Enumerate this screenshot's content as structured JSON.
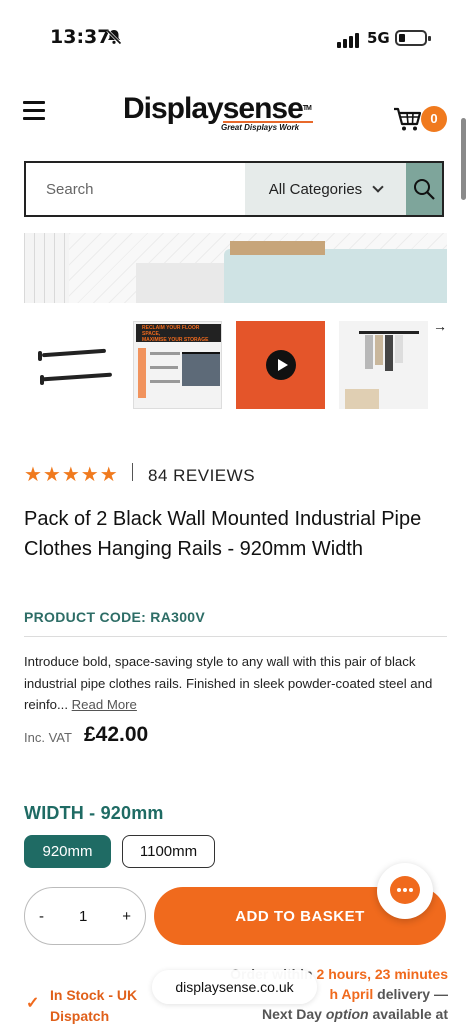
{
  "status_bar": {
    "time": "13:37",
    "network": "5G"
  },
  "header": {
    "logo_main": "Displaysense",
    "logo_tm": "TM",
    "logo_tagline": "Great Displays Work",
    "cart_count": "0"
  },
  "search": {
    "placeholder": "Search",
    "category": "All Categories"
  },
  "gallery": {
    "thumb2_lines": [
      "RECLAIM YOUR FLOOR SPACE,",
      "MAXIMISE YOUR STORAGE"
    ]
  },
  "reviews": {
    "stars": "★★★★★",
    "count_label": "84 REVIEWS"
  },
  "product": {
    "title": "Pack of 2 Black Wall Mounted Industrial Pipe Clothes Hanging Rails - 920mm Width",
    "code": "PRODUCT CODE: RA300V",
    "description": "Introduce bold, space-saving style to any wall with this pair of black industrial pipe clothes rails. Finished in sleek powder-coated steel and reinfo...",
    "read_more": "Read More",
    "vat_label": "Inc. VAT",
    "price": "£42.00"
  },
  "width": {
    "label": "WIDTH - 920mm",
    "options": [
      "920mm",
      "1100mm"
    ],
    "selected": "920mm"
  },
  "purchase": {
    "qty_minus": "-",
    "qty_value": "1",
    "qty_plus": "+",
    "add_label": "ADD TO BASKET"
  },
  "stock": {
    "label": "In Stock - UK Dispatch",
    "delivery_line1_prefix": "Order within",
    "delivery_line1_highlight": "2 hours, 23 minutes",
    "delivery_line2_highlight": "h April",
    "delivery_line2_suffix": "delivery —",
    "delivery_line3_prefix": "Next Day",
    "delivery_line3_italic": "option",
    "delivery_line3_suffix": "available at"
  },
  "browser": {
    "url": "displaysense.co.uk"
  },
  "colors": {
    "accent_orange": "#f06a1d",
    "accent_teal": "#1f6b64",
    "search_button": "#7ea59b"
  }
}
